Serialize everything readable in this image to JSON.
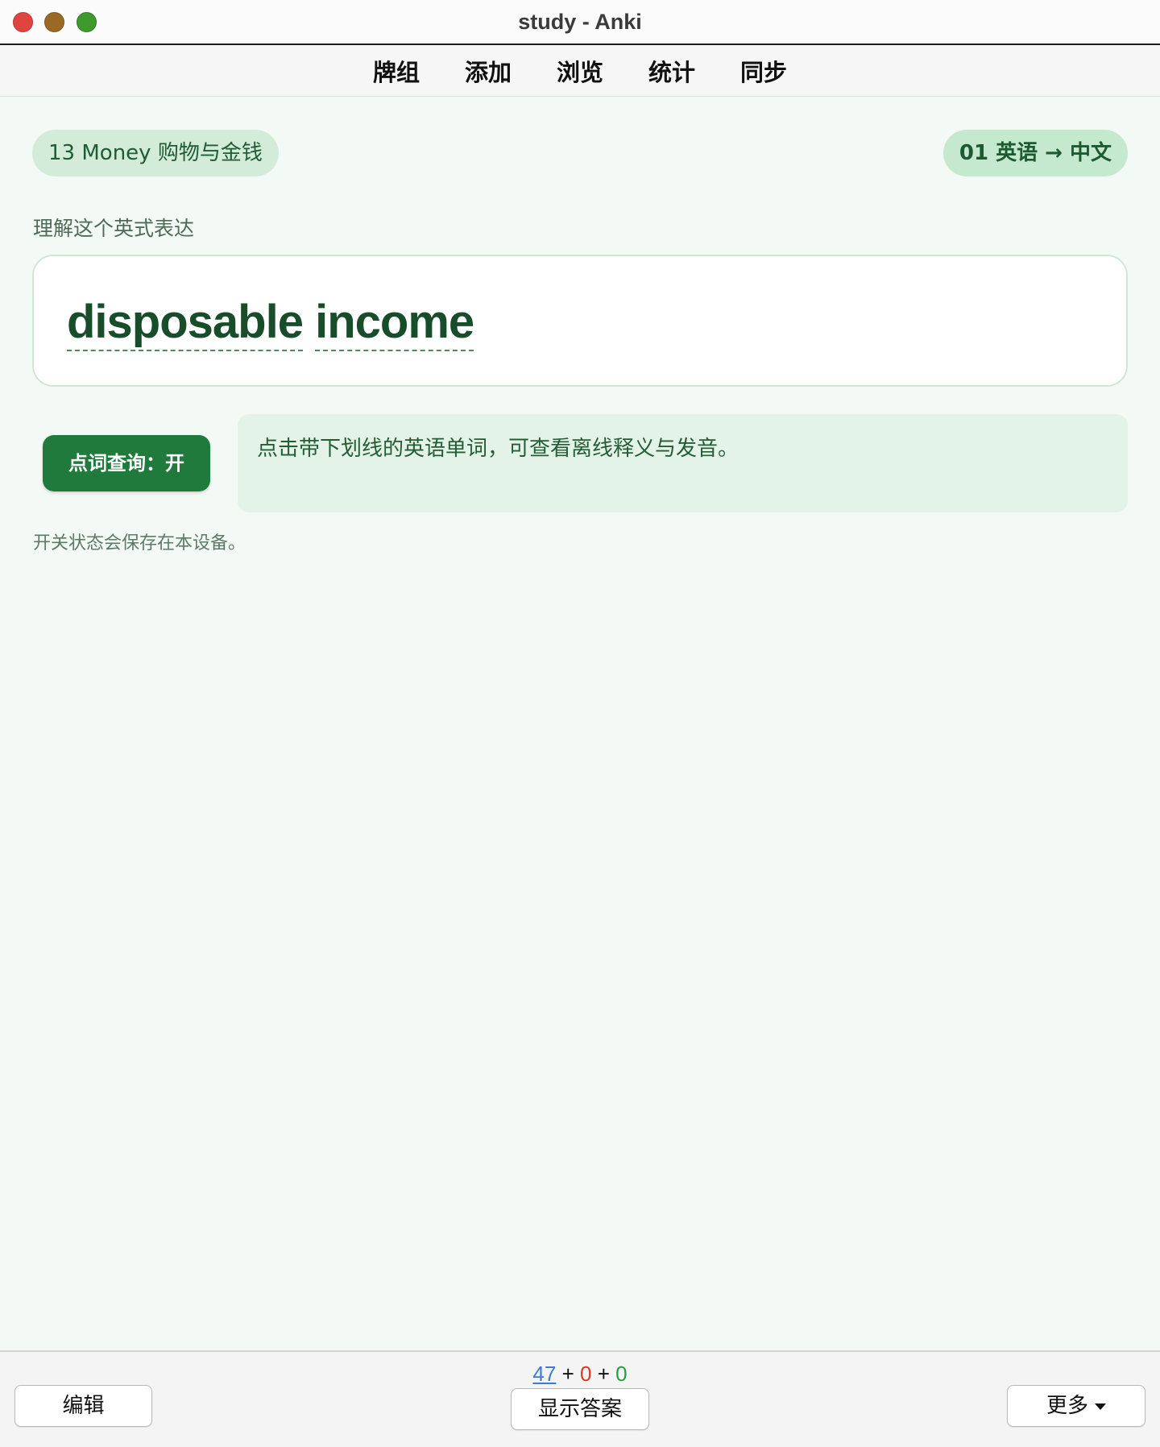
{
  "window": {
    "title": "study - Anki"
  },
  "toolbar": {
    "items": [
      "牌组",
      "添加",
      "浏览",
      "统计",
      "同步"
    ]
  },
  "card": {
    "deck": "13 Money 购物与金钱",
    "mode": "01 英语 → 中文",
    "prompt": "理解这个英式表达",
    "words": [
      "disposable",
      "income"
    ],
    "toggle_label": "点词查询：开",
    "hint": "点击带下划线的英语单词，可查看离线释义与发音。",
    "note": "开关状态会保存在本设备。"
  },
  "bottombar": {
    "counts": {
      "new": "47",
      "sep1": "+",
      "learn": "0",
      "sep2": "+",
      "review": "0"
    },
    "edit_label": "编辑",
    "show_answer_label": "显示答案",
    "more_label": "更多"
  },
  "colors": {
    "accent": "#1f7a3c",
    "background": "#f3f9f4",
    "count_new": "#3b7bd6",
    "count_learn": "#d63a2c",
    "count_review": "#23a046"
  }
}
